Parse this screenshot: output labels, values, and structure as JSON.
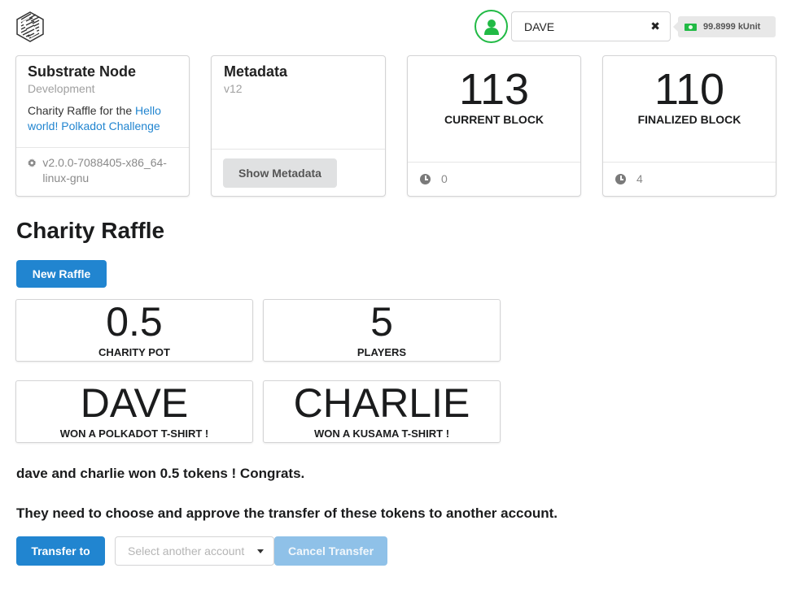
{
  "header": {
    "account_name": "DAVE",
    "clear_symbol": "✖",
    "balance": "99.8999 kUnit"
  },
  "node_card": {
    "title": "Substrate Node",
    "meta": "Development",
    "desc_prefix": "Charity Raffle for the ",
    "desc_link": "Hello world! Polkadot Challenge",
    "version": "v2.0.0-7088405-x86_64-linux-gnu"
  },
  "metadata_card": {
    "title": "Metadata",
    "version": "v12",
    "button": "Show Metadata"
  },
  "current_block": {
    "value": "113",
    "label": "CURRENT BLOCK",
    "timer": "0"
  },
  "finalized_block": {
    "value": "110",
    "label": "FINALIZED BLOCK",
    "timer": "4"
  },
  "raffle": {
    "heading": "Charity Raffle",
    "new_button": "New Raffle",
    "pot_value": "0.5",
    "pot_label": "CHARITY POT",
    "players_value": "5",
    "players_label": "PLAYERS",
    "winner1_name": "DAVE",
    "winner1_prize": "WON A POLKADOT T-SHIRT !",
    "winner2_name": "CHARLIE",
    "winner2_prize": "WON A KUSAMA T-SHIRT !",
    "message1": "dave and charlie won 0.5 tokens ! Congrats.",
    "message2": "They need to choose and approve the transfer of these tokens to another account.",
    "transfer_button": "Transfer to",
    "select_placeholder": "Select another account",
    "cancel_button": "Cancel Transfer"
  },
  "colors": {
    "primary": "#2185d0",
    "primary_disabled": "#8fc1e8",
    "success": "#21ba45"
  }
}
